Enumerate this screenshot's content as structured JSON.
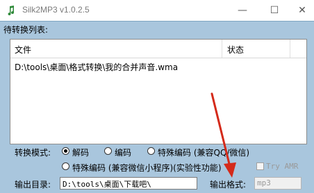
{
  "window": {
    "title": "Silk2MP3 v1.0.2.5",
    "controls": {
      "minimize": "—",
      "maximize": "☐",
      "close": "✕"
    }
  },
  "group": {
    "caption": "待转换列表:"
  },
  "list": {
    "columns": {
      "file": "文件",
      "status": "状态"
    },
    "rows": [
      {
        "file": "D:\\tools\\桌面\\格式转换\\我的合并声音.wma",
        "status": ""
      }
    ]
  },
  "mode": {
    "label": "转换模式:",
    "options": [
      {
        "label": "解码",
        "checked": true
      },
      {
        "label": "编码",
        "checked": false
      },
      {
        "label": "特殊编码 (兼容QQ/微信)",
        "checked": false
      },
      {
        "label": "特殊编码 (兼容微信小程序)(实验性功能)",
        "checked": false
      }
    ],
    "try_amr": {
      "label": "Try AMR",
      "checked": false
    }
  },
  "output": {
    "dir_label": "输出目录:",
    "dir_value": "D:\\tools\\桌面\\下载吧\\",
    "format_label": "输出格式:",
    "format_value": "mp3"
  },
  "colors": {
    "panel": "#a9c6dd",
    "arrow": "#d42a1a"
  }
}
